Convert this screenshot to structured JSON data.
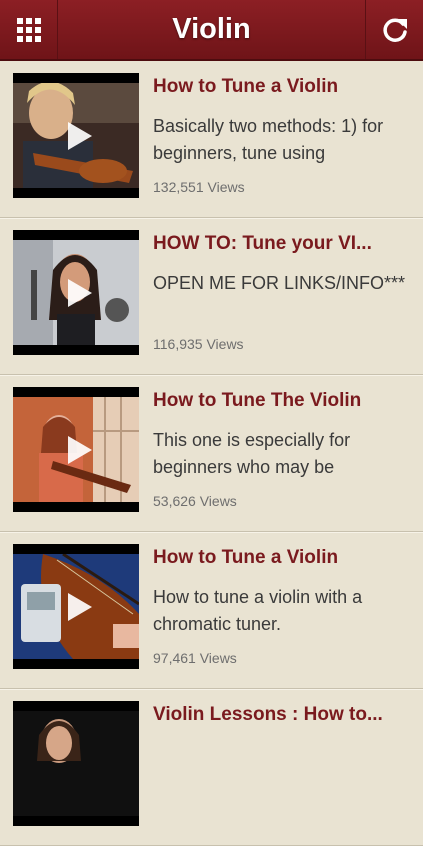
{
  "header": {
    "title": "Violin",
    "menu_icon": "grid-menu-icon",
    "refresh_icon": "refresh-icon"
  },
  "videos": [
    {
      "title": "How to Tune a Violin",
      "description": "Basically two methods: 1) for beginners, tune using",
      "views": "132,551 Views"
    },
    {
      "title": "HOW TO: Tune your VI...",
      "description": "OPEN ME FOR LINKS/INFO***",
      "views": "116,935 Views"
    },
    {
      "title": "How to Tune The Violin",
      "description": "This one is especially for beginners who may be",
      "views": "53,626 Views"
    },
    {
      "title": "How to Tune a Violin",
      "description": "How to tune a violin with a chromatic tuner.",
      "views": "97,461 Views"
    },
    {
      "title": "Violin Lessons : How to...",
      "description": "",
      "views": ""
    }
  ],
  "colors": {
    "header": "#7a1a1e",
    "background": "#e9e3d2",
    "title_text": "#7a1a1e"
  }
}
